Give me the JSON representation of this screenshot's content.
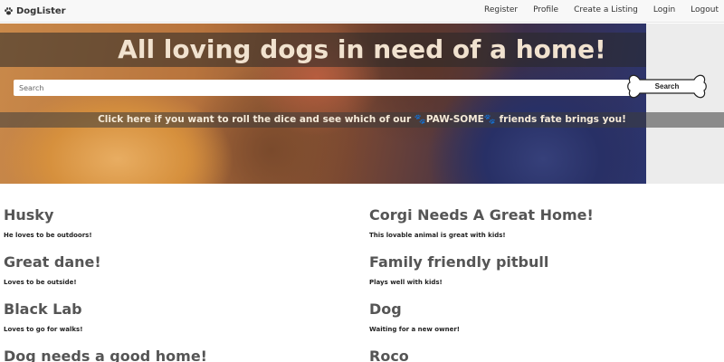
{
  "navbar": {
    "brand": "DogLister",
    "links": [
      "Register",
      "Profile",
      "Create a Listing",
      "Login",
      "Logout"
    ]
  },
  "hero": {
    "title": "All loving dogs in need of a home!",
    "search": {
      "placeholder": "Search",
      "button_label": "Search"
    },
    "random_link": "Click here if you want to roll the dice and see which of our 🐾PAW-SOME🐾 friends fate brings you!"
  },
  "listings": [
    {
      "title": "Husky",
      "description": "He loves to be outdoors!"
    },
    {
      "title": "Corgi Needs A Great Home!",
      "description": "This lovable animal is great with kids!"
    },
    {
      "title": "Great dane!",
      "description": "Loves to be outside!"
    },
    {
      "title": "Family friendly pitbull",
      "description": "Plays well with kids!"
    },
    {
      "title": "Black Lab",
      "description": "Loves to go for walks!"
    },
    {
      "title": "Dog",
      "description": "Waiting for a new owner!"
    },
    {
      "title": "Dog needs a good home!",
      "description": ""
    },
    {
      "title": "Roco",
      "description": ""
    }
  ]
}
